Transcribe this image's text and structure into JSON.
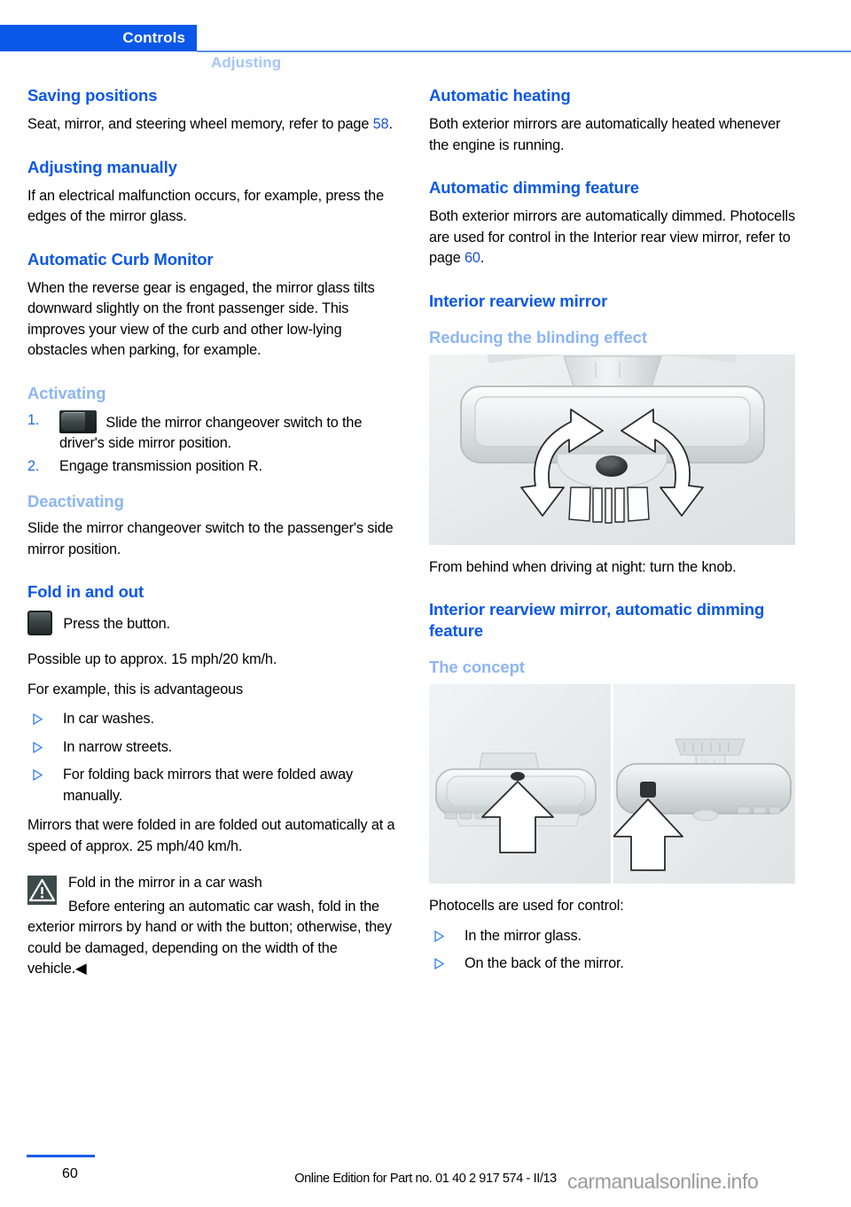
{
  "header": {
    "active_tab": "Controls",
    "inactive_tab": "Adjusting",
    "accent_color": "#0b57e8",
    "muted_accent_color": "#8cb6f2"
  },
  "left_column": {
    "saving_positions": {
      "heading": "Saving positions",
      "body_before": "Seat, mirror, and steering wheel memory, refer to page ",
      "page_ref": "58",
      "body_after": "."
    },
    "adjusting_manually": {
      "heading": "Adjusting manually",
      "body": "If an electrical malfunction occurs, for example, press the edges of the mirror glass."
    },
    "automatic_curb_monitor": {
      "heading": "Automatic Curb Monitor",
      "body": "When the reverse gear is engaged, the mirror glass tilts downward slightly on the front passenger side. This improves your view of the curb and other low-lying obstacles when parking, for example."
    },
    "activating": {
      "heading": "Activating",
      "steps": [
        {
          "number": "1.",
          "icon": "mirror-changeover-switch-icon",
          "text": "Slide the mirror changeover switch to the driver's side mirror position."
        },
        {
          "number": "2.",
          "icon": "",
          "text": "Engage transmission position R."
        }
      ]
    },
    "deactivating": {
      "heading": "Deactivating",
      "body": "Slide the mirror changeover switch to the passenger's side mirror position."
    },
    "fold_in_and_out": {
      "heading": "Fold in and out",
      "button_line": "Press the button.",
      "speed_line": "Possible up to approx. 15 mph/20 km/h.",
      "example_intro": "For example, this is advantageous",
      "bullets": [
        "In car washes.",
        "In narrow streets.",
        "For folding back mirrors that were folded away manually."
      ],
      "auto_unfold": "Mirrors that were folded in are folded out automatically at a speed of approx. 25 mph/40 km/h."
    },
    "warning": {
      "icon": "warning-triangle-icon",
      "title": "Fold in the mirror in a car wash",
      "body": "Before entering an automatic car wash, fold in the exterior mirrors by hand or with the button; otherwise, they could be damaged, depending on the width of the vehicle.◀"
    }
  },
  "right_column": {
    "automatic_heating": {
      "heading": "Automatic heating",
      "body": "Both exterior mirrors are automatically heated whenever the engine is running."
    },
    "automatic_dimming_feature": {
      "heading": "Automatic dimming feature",
      "body_before": "Both exterior mirrors are automatically dimmed. Photocells are used for control in the Interior rear view mirror, refer to page ",
      "page_ref": "60",
      "body_after": "."
    },
    "interior_rearview_mirror": {
      "heading": "Interior rearview mirror",
      "subheading": "Reducing the blinding effect",
      "figure_name": "interior-mirror-knob-rotation-figure",
      "caption": "From behind when driving at night: turn the knob."
    },
    "interior_rearview_mirror_auto": {
      "heading": "Interior rearview mirror, automatic dimming feature",
      "subheading": "The concept",
      "figure_name": "photocell-locations-figure",
      "intro": "Photocells are used for control:",
      "bullets": [
        "In the mirror glass.",
        "On the back of the mirror."
      ]
    }
  },
  "footer": {
    "page_number": "60",
    "edition": "Online Edition for Part no. 01 40 2 917 574 - II/13",
    "watermark": "carmanualsonline.info"
  }
}
